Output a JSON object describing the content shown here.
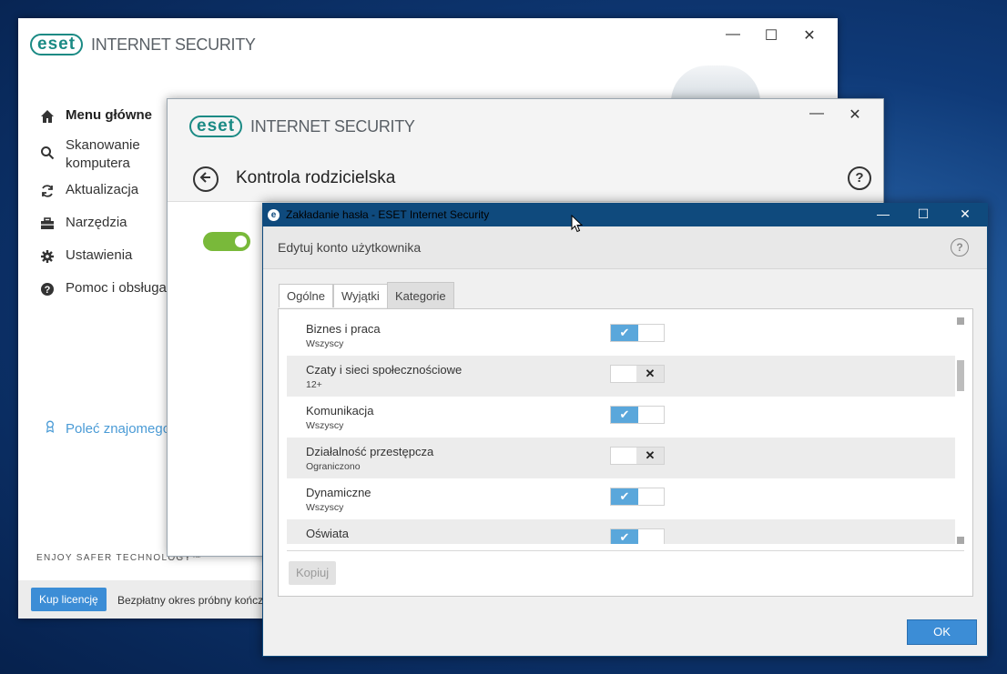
{
  "main_window": {
    "logo": "eset",
    "product": "INTERNET SECURITY",
    "controls": {
      "minimize": "—",
      "maximize": "☐",
      "close": "✕"
    },
    "nav": [
      {
        "label": "Menu główne",
        "icon": "home-icon"
      },
      {
        "label": "Skanowanie komputera",
        "icon": "search-icon"
      },
      {
        "label": "Aktualizacja",
        "icon": "refresh-icon"
      },
      {
        "label": "Narzędzia",
        "icon": "toolbox-icon"
      },
      {
        "label": "Ustawienia",
        "icon": "gear-icon"
      },
      {
        "label": "Pomoc i obsługa",
        "icon": "help-icon"
      }
    ],
    "recommend": "Poleć znajomego",
    "tagline": "ENJOY SAFER TECHNOLOGY™",
    "buy_button": "Kup licencję",
    "trial_text": "Bezpłatny okres próbny kończy"
  },
  "parental_window": {
    "logo": "eset",
    "product": "INTERNET SECURITY",
    "title": "Kontrola rodzicielska",
    "help": "?",
    "controls": {
      "minimize": "—",
      "close": "✕"
    }
  },
  "dialog": {
    "title": "Zakładanie hasła - ESET Internet Security",
    "app_icon": "e",
    "controls": {
      "minimize": "—",
      "maximize": "☐",
      "close": "✕"
    },
    "subtitle": "Edytuj konto użytkownika",
    "help": "?",
    "tabs": [
      {
        "label": "Ogólne",
        "active": false
      },
      {
        "label": "Wyjątki",
        "active": false
      },
      {
        "label": "Kategorie",
        "active": true
      }
    ],
    "categories": [
      {
        "name": "Biznes i praca",
        "sub": "Wszyscy",
        "allowed": true
      },
      {
        "name": "Czaty i sieci społecznościowe",
        "sub": "12+",
        "allowed": false
      },
      {
        "name": "Komunikacja",
        "sub": "Wszyscy",
        "allowed": true
      },
      {
        "name": "Działalność przestępcza",
        "sub": "Ograniczono",
        "allowed": false
      },
      {
        "name": "Dynamiczne",
        "sub": "Wszyscy",
        "allowed": true
      },
      {
        "name": "Oświata",
        "sub": "",
        "allowed": true
      }
    ],
    "copy_button": "Kopiuj",
    "ok_button": "OK"
  }
}
